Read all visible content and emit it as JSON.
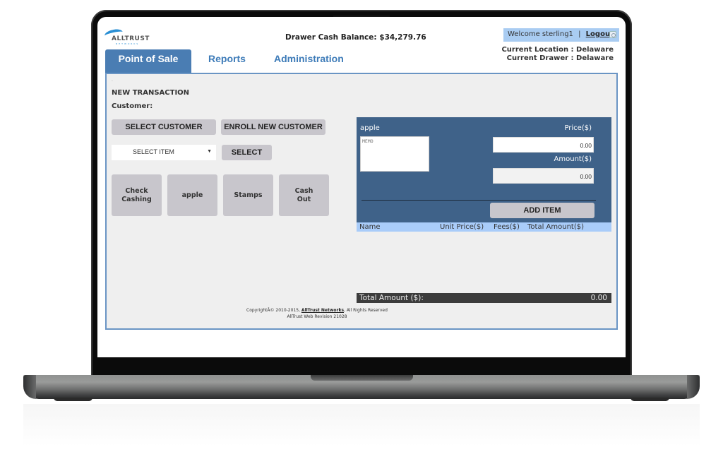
{
  "header": {
    "logo_text": "ALLTRUST",
    "logo_subtext": "NETWORKS",
    "drawer_balance_label": "Drawer Cash Balance:",
    "drawer_balance_value": "$34,279.76",
    "welcome_text": "Welcome sterling1",
    "separator": "|",
    "logout_label": "Logout",
    "current_location": "Current Location : Delaware",
    "current_drawer": "Current Drawer : Delaware"
  },
  "tabs": [
    {
      "label": "Point of Sale",
      "active": true
    },
    {
      "label": "Reports",
      "active": false
    },
    {
      "label": "Administration",
      "active": false
    }
  ],
  "transaction": {
    "dots": "..",
    "title": "NEW TRANSACTION",
    "customer_label": "Customer:",
    "select_customer_label": "SELECT CUSTOMER",
    "enroll_customer_label": "ENROLL NEW CUSTOMER",
    "select_item_value": "SELECT ITEM",
    "select_button_label": "SELECT",
    "quick_items": [
      {
        "label": "Check Cashing"
      },
      {
        "label": "apple"
      },
      {
        "label": "Stamps"
      },
      {
        "label": "Cash Out"
      }
    ]
  },
  "item_editor": {
    "item_name": "apple",
    "memo_placeholder": "MEMO",
    "price_label": "Price($)",
    "price_value": "0.00",
    "amount_label": "Amount($)",
    "amount_value": "0.00",
    "add_item_label": "ADD ITEM"
  },
  "cart": {
    "columns": [
      "Name",
      "Unit Price($)",
      "Fees($)",
      "Total Amount($)"
    ],
    "rows": [],
    "total_label": "Total Amount ($):",
    "total_value": "0.00"
  },
  "footer": {
    "copyright_prefix": "CopyrightÂ© 2010-2015,",
    "company_link": "AllTrust Networks",
    "copyright_suffix": ", All Rights Reserved",
    "revision": "AllTrust Web Revision 21028"
  },
  "colors": {
    "tab_active": "#4a7db3",
    "tab_text": "#3d7bb8",
    "item_panel": "#3f6289",
    "cart_header": "#a9ccf9",
    "welcome_bar": "#a9ccf2",
    "total_bar": "#3c3c3c",
    "button": "#c8c6cc"
  }
}
